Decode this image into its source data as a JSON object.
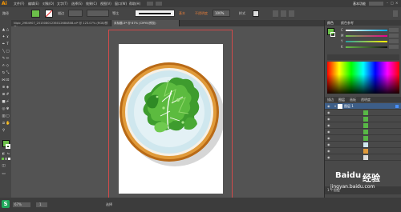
{
  "app": {
    "logo": "Ai",
    "menu": [
      "文件(F)",
      "编辑(E)",
      "对象(O)",
      "文字(T)",
      "选择(S)",
      "效果(C)",
      "视图(V)",
      "窗口(W)",
      "帮助(H)"
    ],
    "workspace": "基本功能"
  },
  "controlbar": {
    "label": "路径",
    "stroke_label": "描边",
    "style_label": "等比",
    "brush_label": "基本",
    "opacity_label": "不透明度",
    "opacity_value": "100%",
    "style2_label": "样式"
  },
  "tabs": [
    {
      "label": "Nipic_2984907_20150801236012684808.ai* @ 123.07% (RGB/预览)",
      "active": false
    },
    {
      "label": "未标题-5* @ 67% (CMYK/预览)",
      "active": true
    }
  ],
  "status": {
    "zoom": "67%",
    "page": "1",
    "mode": "选择"
  },
  "watermark": {
    "brand": "Baidu",
    "text": "经验",
    "url": "jingyan.baidu.com"
  },
  "colors": {
    "fill": "#6cc04a",
    "stroke": "#ffffff",
    "plate_outer": "#d98a2b",
    "plate_inner": "#cfe7ee",
    "lettuce": "#4fae3a"
  },
  "panels": {
    "color_tabs": [
      "颜色",
      "颜色参考"
    ],
    "color_channels": [
      "C",
      "M",
      "Y",
      "K"
    ],
    "layer_tabs": [
      "描边",
      "图层",
      "画板",
      "透明度"
    ],
    "layer_name": "图层 1",
    "layers_count_label": "1 个图层"
  }
}
